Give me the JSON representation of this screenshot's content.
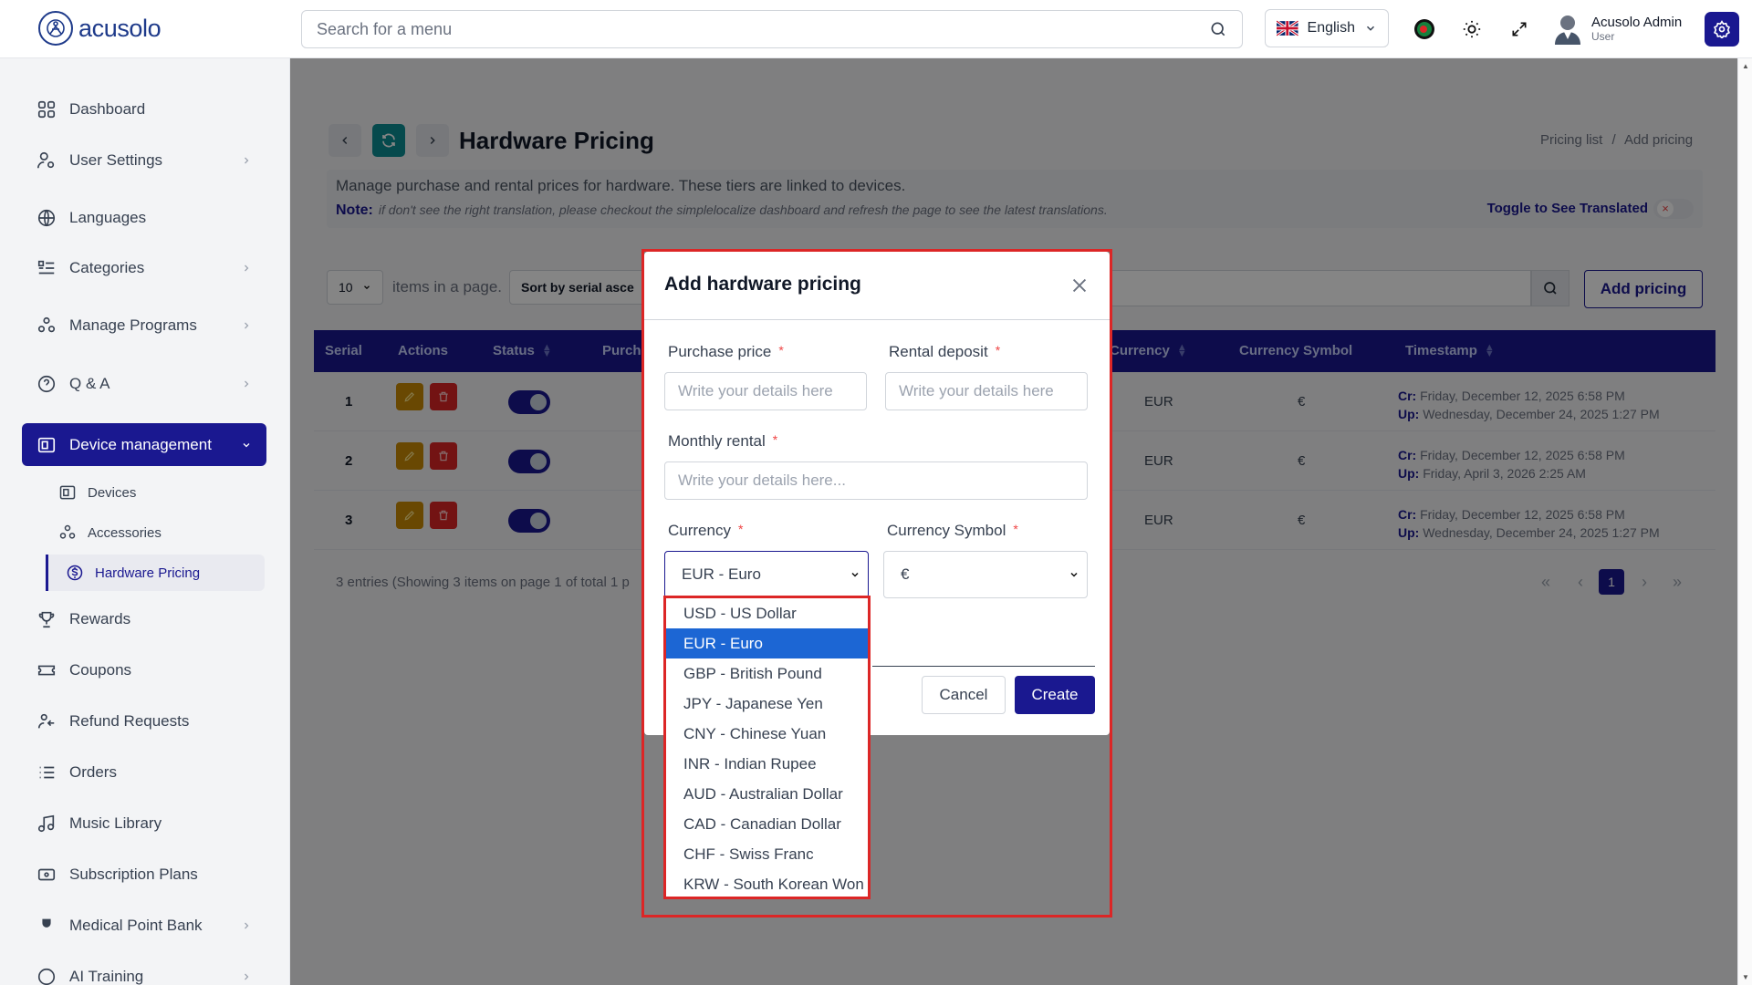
{
  "header": {
    "logo_text": "acusolo",
    "search_placeholder": "Search for a menu",
    "language": "English",
    "user_name": "Acusolo Admin",
    "user_role": "User"
  },
  "sidebar": {
    "items": [
      {
        "label": "Dashboard",
        "icon": "dashboard-icon"
      },
      {
        "label": "User Settings",
        "icon": "user-settings-icon"
      },
      {
        "label": "Languages",
        "icon": "globe-icon"
      },
      {
        "label": "Categories",
        "icon": "categories-icon"
      },
      {
        "label": "Manage Programs",
        "icon": "programs-icon"
      },
      {
        "label": "Q & A",
        "icon": "qa-icon"
      },
      {
        "label": "Device management",
        "icon": "device-icon"
      },
      {
        "label": "Rewards",
        "icon": "trophy-icon"
      },
      {
        "label": "Coupons",
        "icon": "coupon-icon"
      },
      {
        "label": "Refund Requests",
        "icon": "refund-icon"
      },
      {
        "label": "Orders",
        "icon": "orders-icon"
      },
      {
        "label": "Music Library",
        "icon": "music-icon"
      },
      {
        "label": "Subscription Plans",
        "icon": "subscription-icon"
      },
      {
        "label": "Medical Point Bank",
        "icon": "medical-icon"
      },
      {
        "label": "AI Training",
        "icon": "ai-icon"
      }
    ],
    "subitems": [
      {
        "label": "Devices"
      },
      {
        "label": "Accessories"
      },
      {
        "label": "Hardware Pricing"
      }
    ]
  },
  "page": {
    "title": "Hardware Pricing",
    "breadcrumb": [
      "Pricing list",
      "/",
      "Add pricing"
    ],
    "description": "Manage purchase and rental prices for hardware. These tiers are linked to devices.",
    "note_label": "Note:",
    "note_text": "if don't see the right translation, please checkout the simplelocalize dashboard and refresh the page to see the latest translations.",
    "toggle_label": "Toggle to See Translated",
    "per_page": "10",
    "items_in_page": "items in a page.",
    "sort_label": "Sort by serial asce",
    "add_button": "Add pricing",
    "entries_text": "3 entries (Showing 3 items on page 1 of total 1 p",
    "current_page": "1"
  },
  "table": {
    "headers": {
      "serial": "Serial",
      "actions": "Actions",
      "status": "Status",
      "purchase": "Purch",
      "currency": "Currency",
      "symbol": "Currency Symbol",
      "timestamp": "Timestamp"
    },
    "rows": [
      {
        "serial": "1",
        "currency": "EUR",
        "symbol": "€",
        "cr_label": "Cr:",
        "cr": "Friday, December 12, 2025 6:58 PM",
        "up_label": "Up:",
        "up": "Wednesday, December 24, 2025 1:27 PM"
      },
      {
        "serial": "2",
        "currency": "EUR",
        "symbol": "€",
        "cr_label": "Cr:",
        "cr": "Friday, December 12, 2025 6:58 PM",
        "up_label": "Up:",
        "up": "Friday, April 3, 2026 2:25 AM"
      },
      {
        "serial": "3",
        "currency": "EUR",
        "symbol": "€",
        "cr_label": "Cr:",
        "cr": "Friday, December 12, 2025 6:58 PM",
        "up_label": "Up:",
        "up": "Wednesday, December 24, 2025 1:27 PM"
      }
    ]
  },
  "modal": {
    "title": "Add hardware pricing",
    "purchase_label": "Purchase price",
    "rental_label": "Rental deposit",
    "monthly_label": "Monthly rental",
    "currency_label": "Currency",
    "symbol_label": "Currency Symbol",
    "required_mark": "*",
    "placeholder_short": "Write your details here",
    "placeholder_full": "Write your details here...",
    "currency_value": "EUR - Euro",
    "symbol_value": "€",
    "cancel": "Cancel",
    "create": "Create",
    "currency_options": [
      "USD - US Dollar",
      "EUR - Euro",
      "GBP - British Pound",
      "JPY - Japanese Yen",
      "CNY - Chinese Yuan",
      "INR - Indian Rupee",
      "AUD - Australian Dollar",
      "CAD - Canadian Dollar",
      "CHF - Swiss Franc",
      "KRW - South Korean Won"
    ],
    "selected_option_index": 1
  },
  "colors": {
    "primary": "#1a1890",
    "teal": "#0d8f95",
    "highlight": "#dc2626",
    "option_selected": "#1c66d4"
  }
}
